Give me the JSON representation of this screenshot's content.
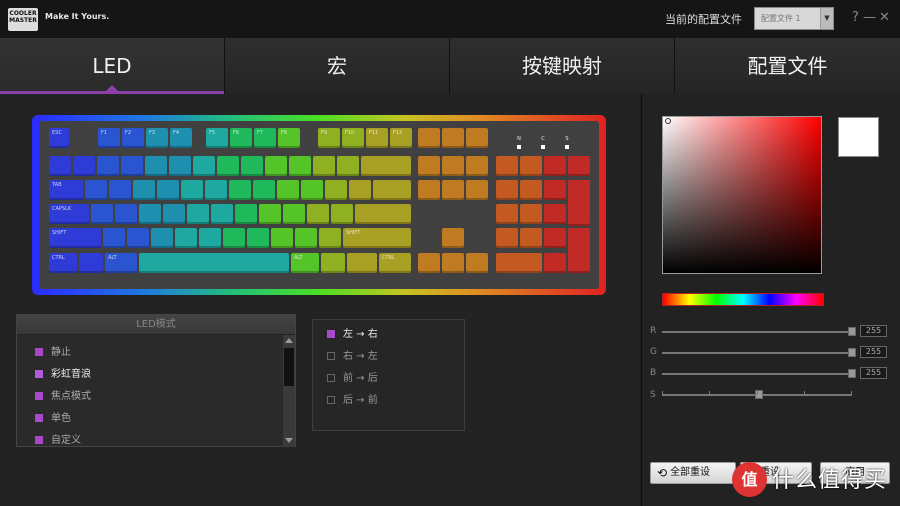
{
  "titlebar": {
    "logo_text": "COOLER MASTER",
    "tagline": "Make It Yours.",
    "profile_label": "当前的配置文件",
    "profile_value": "配置文件 1",
    "help": "?",
    "minimize": "—",
    "close": "✕"
  },
  "tabs": [
    {
      "label": "LED",
      "active": true
    },
    {
      "label": "宏"
    },
    {
      "label": "按键映射"
    },
    {
      "label": "配置文件"
    }
  ],
  "keyboard": {
    "indicators": [
      "N",
      "C",
      "S"
    ],
    "colors": {
      "blue": "#2f3bd6",
      "indigo": "#2b55d0",
      "teal": "#1f8fb0",
      "cyan": "#1ea8a0",
      "green": "#1fb85a",
      "lime": "#55c428",
      "yellowgreen": "#8fb020",
      "olive": "#a8a024",
      "orange": "#c07a22",
      "darkorange": "#c45a22",
      "red": "#c22a26"
    },
    "labels": {
      "esc": "ESC",
      "f1": "F1",
      "f2": "F2",
      "f3": "F3",
      "f4": "F4",
      "f5": "F5",
      "f6": "F6",
      "f7": "F7",
      "f8": "F8",
      "f9": "F9",
      "f10": "F10",
      "f11": "F11",
      "f12": "F12",
      "tab": "TAB",
      "caps": "CAPSLK",
      "shift": "SHIFT",
      "ctrl": "CTRL",
      "alt": "ALT"
    }
  },
  "led_mode": {
    "header": "LED模式",
    "items": [
      {
        "label": "静止",
        "selected": false
      },
      {
        "label": "彩虹音浪",
        "selected": true
      },
      {
        "label": "焦点模式",
        "selected": false
      },
      {
        "label": "单色",
        "selected": false
      },
      {
        "label": "自定义",
        "selected": false
      }
    ]
  },
  "direction": {
    "items": [
      {
        "label": "左 → 右",
        "checked": true
      },
      {
        "label": "右 → 左",
        "checked": false
      },
      {
        "label": "前 → 后",
        "checked": false
      },
      {
        "label": "后 → 前",
        "checked": false
      }
    ]
  },
  "color_picker": {
    "current_color": "#ffffff",
    "channels": [
      {
        "label": "R",
        "value": "255"
      },
      {
        "label": "G",
        "value": "255"
      },
      {
        "label": "B",
        "value": "255"
      },
      {
        "label": "S",
        "value": ""
      }
    ]
  },
  "buttons": {
    "reset_all": "全部重设",
    "reset": "重设",
    "apply": "应用"
  },
  "watermark": {
    "badge": "值",
    "text": "什么值得买"
  }
}
